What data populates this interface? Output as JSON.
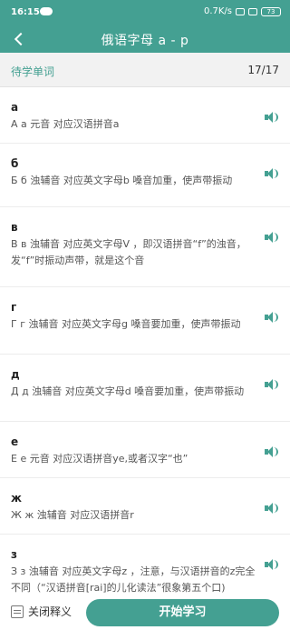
{
  "status_bar": {
    "time": "16:15",
    "network_speed": "0.7K/s",
    "battery": "73"
  },
  "header": {
    "title": "俄语字母  a - p"
  },
  "subheader": {
    "label": "待学单词",
    "count": "17/17"
  },
  "items": [
    {
      "word": "а",
      "desc": "А а 元音 对应汉语拼音a"
    },
    {
      "word": "б",
      "desc": "Б б 浊辅音 对应英文字母b 嗓音加重，使声带振动"
    },
    {
      "word": "в",
      "desc": "В в 浊辅音 对应英文字母V ，即汉语拼音“f”的浊音，发“f”时振动声带，就是这个音"
    },
    {
      "word": "г",
      "desc": "Г г 浊辅音 对应英文字母g 嗓音要加重，使声带振动"
    },
    {
      "word": "д",
      "desc": "Д д 浊辅音 对应英文字母d 嗓音要加重，使声带振动"
    },
    {
      "word": "е",
      "desc": "Е е 元音 对应汉语拼音ye,或者汉字“也”"
    },
    {
      "word": "ж",
      "desc": "Ж ж 浊辅音 对应汉语拼音r"
    },
    {
      "word": "з",
      "desc": "З з 浊辅音 对应英文字母z ，注意，与汉语拼音的z完全不同（“汉语拼音[rai]的儿化读法”很象第五个口)"
    }
  ],
  "bottom": {
    "toggle_label": "关闭释义",
    "start_label": "开始学习"
  },
  "colors": {
    "accent": "#44a092"
  },
  "icons": {
    "back": "back-arrow-icon",
    "speaker": "speaker-icon",
    "toggle": "document-icon"
  }
}
